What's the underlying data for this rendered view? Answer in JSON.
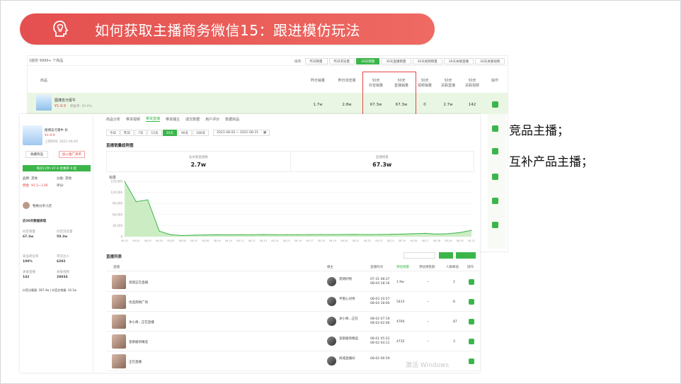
{
  "banner": {
    "title": "如何获取主播商务微信15：跟进模仿玩法"
  },
  "side_notes": [
    "竞品主播；",
    "互补产品主播；"
  ],
  "back_table": {
    "count_label": "1版份 9999+ 个商品",
    "sort_label": "排序:",
    "sort_buttons": [
      "昨日销量",
      "昨日浏览量",
      "30天销量",
      "30天直播销量",
      "30天视频销量",
      "30天关联直播",
      "30天关联视频"
    ],
    "sort_active_index": 2,
    "columns": [
      "商品",
      "昨日销量",
      "昨日浏览量",
      "30天\n抖音销量",
      "30天\n直播销量",
      "30天\n视频销量",
      "30天\n关联直播",
      "30天\n关联视频",
      "操作"
    ],
    "row": {
      "name": "图博去污膏牛",
      "price": "¥1-9.9",
      "commission": "佣金率: 20.0%",
      "values": [
        "1.7w",
        "2.8w",
        "67.3w",
        "67.3w",
        "0",
        "2.7w",
        "142"
      ]
    }
  },
  "front": {
    "left": {
      "product_name": "图博去污膏牛 抖",
      "price": "¥1-9.9",
      "launch": "上架时间: 2021-06-05",
      "collect": "收藏商品",
      "promo": "加入推广清单",
      "go_btn": "购买(1件) ¥7.9 优惠券 9 起",
      "brand": "品牌: 其他",
      "category": "分类: 其他",
      "commission": "佣金: ¥1.5~1.66",
      "rate": "评分:",
      "owner_shop": "物果分享小店",
      "recent_title": "近30天数据表现",
      "metrics": [
        {
          "label": "抖音销量",
          "value": "67.3w"
        },
        {
          "label": "抖音浏览量",
          "value": "50.3w"
        },
        {
          "label": "商品转化率",
          "value": "100%"
        },
        {
          "label": "带货达人",
          "value": "6202"
        },
        {
          "label": "关联直播",
          "value": "142"
        },
        {
          "label": "关联视频",
          "value": "28034"
        }
      ],
      "footer": "抖音访客量: 287.4w | 抖音总销量: 34.1w"
    },
    "tabs": [
      "商品分析",
      "带货视频",
      "带货直播",
      "带货播主",
      "成交数据",
      "用户评价",
      "数据商品"
    ],
    "tab_active_index": 2,
    "date_buttons": [
      "今日",
      "昨日",
      "7天",
      "15天",
      "30天",
      "90天",
      "180天"
    ],
    "date_active_index": 4,
    "date_range": "2021-08-02 ~ 2021-08-31",
    "trend_title": "直播销量趋势图",
    "stats": [
      {
        "label": "总关联直播数",
        "value": "2.7w"
      },
      {
        "label": "直播销量",
        "value": "67.3w"
      }
    ],
    "chart_ylabel": "销量",
    "list_title": "直播列表",
    "list_columns": [
      "直播",
      "播主",
      "直播时间",
      "预估销量",
      "预估销售额",
      "人数峰值",
      "操作"
    ],
    "rows": [
      {
        "title": "测测正在直播",
        "host": "测测好物",
        "time": "07-31 08:37\n08-04 18:16",
        "sales": "1.9w",
        "amount": "--",
        "peak": "2"
      },
      {
        "title": "优选购物广场",
        "host": "平南心对待",
        "time": "08-03 10:57\n08-04 18:00",
        "sales": "5433",
        "amount": "--",
        "peak": "8"
      },
      {
        "title": "沐小奇...正在直播",
        "host": "沐小奇...正在",
        "time": "08-02 07:19\n08-03 02:06",
        "sales": "4760",
        "amount": "--",
        "peak": "87"
      },
      {
        "title": "宽斯服饰精选",
        "host": "宽斯服饰精选",
        "time": "08-01 05:22\n08-02 04:11",
        "sales": "4735",
        "amount": "--",
        "peak": "3"
      },
      {
        "title": "正在直播",
        "host": "商城直播间",
        "time": "08-02 06:59",
        "sales": "",
        "amount": "",
        "peak": ""
      }
    ]
  },
  "watermark": "激活 Windows",
  "chart_data": {
    "type": "area",
    "ylabel": "销量",
    "x": [
      "08-01",
      "08-02",
      "08-03",
      "08-04",
      "08-05",
      "08-06",
      "08-07",
      "08-08",
      "08-09",
      "08-10",
      "08-11",
      "08-12",
      "08-13",
      "08-14",
      "08-15",
      "08-16",
      "08-17",
      "08-18",
      "08-19",
      "08-20",
      "08-21",
      "08-22",
      "08-23",
      "08-24",
      "08-25",
      "08-26",
      "08-27",
      "08-28",
      "08-29",
      "08-30",
      "08-31"
    ],
    "y_ticks": [
      "150,000",
      "120,000",
      "90,000",
      "60,000",
      "30,000",
      "0"
    ],
    "ylim": [
      0,
      150000
    ],
    "values": [
      150000,
      95000,
      100000,
      15000,
      5000,
      3000,
      4000,
      4500,
      5000,
      4800,
      5200,
      5000,
      5500,
      5300,
      5000,
      5200,
      5400,
      5600,
      5200,
      5800,
      6000,
      5500,
      5700,
      6200,
      7000,
      8000,
      9000,
      7000,
      8000,
      11000,
      17000
    ],
    "color": "#3bb54a"
  }
}
